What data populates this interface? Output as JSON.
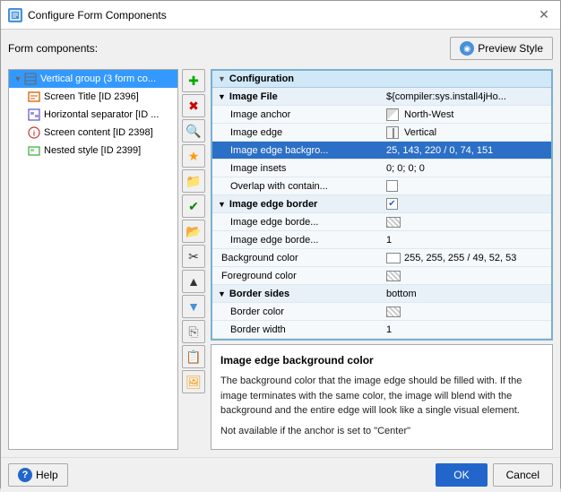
{
  "dialog": {
    "title": "Configure Form Components",
    "title_icon": "⚙",
    "close_icon": "✕"
  },
  "header": {
    "form_components_label": "Form components:",
    "preview_style_label": "Preview Style",
    "preview_style_icon": "◉"
  },
  "tree": {
    "items": [
      {
        "id": "vertical-group",
        "label": "Vertical group (3 form co...",
        "indent": 0,
        "expanded": true,
        "selected": false,
        "icon": "vgroup"
      },
      {
        "id": "screen-title",
        "label": "Screen Title [ID 2396]",
        "indent": 1,
        "selected": false,
        "icon": "screen-title"
      },
      {
        "id": "horizontal-sep",
        "label": "Horizontal separator [ID ...",
        "indent": 1,
        "selected": false,
        "icon": "hsep"
      },
      {
        "id": "screen-content",
        "label": "Screen content [ID 2398]",
        "indent": 1,
        "selected": false,
        "icon": "screen-content"
      },
      {
        "id": "nested-style",
        "label": "Nested style [ID 2399]",
        "indent": 1,
        "selected": false,
        "icon": "nested"
      }
    ]
  },
  "toolbar": {
    "buttons": [
      "add",
      "remove",
      "search",
      "star",
      "folder",
      "check",
      "blue-folder",
      "scissors",
      "up",
      "down",
      "copy",
      "paste",
      "img"
    ]
  },
  "config": {
    "header_label": "Configuration",
    "rows": [
      {
        "type": "group",
        "label": "Image File",
        "value": "${compiler:sys.install4jHo...",
        "indent": 0
      },
      {
        "type": "row",
        "label": "Image anchor",
        "value": "North-West",
        "indent": 1,
        "value_icon": "anchor"
      },
      {
        "type": "row",
        "label": "Image edge",
        "value": "Vertical",
        "indent": 1,
        "value_icon": "vline"
      },
      {
        "type": "row",
        "label": "Image edge backgro...",
        "value": "25, 143, 220 / 0, 74, 151",
        "indent": 1,
        "selected": true
      },
      {
        "type": "row",
        "label": "Image insets",
        "value": "0; 0; 0; 0",
        "indent": 1
      },
      {
        "type": "row",
        "label": "Overlap with contain...",
        "value": "",
        "indent": 1,
        "value_icon": "checkbox"
      },
      {
        "type": "group",
        "label": "Image edge border",
        "value": "",
        "indent": 0,
        "checked": true
      },
      {
        "type": "row",
        "label": "Image edge borde...",
        "value": "",
        "indent": 1,
        "value_icon": "pattern"
      },
      {
        "type": "row",
        "label": "Image edge borde...",
        "value": "1",
        "indent": 1
      },
      {
        "type": "plain",
        "label": "Background color",
        "value": "255, 255, 255 / 49, 52, 53",
        "indent": 0,
        "value_icon": "color-white"
      },
      {
        "type": "plain",
        "label": "Foreground color",
        "value": "",
        "indent": 0,
        "value_icon": "pattern"
      },
      {
        "type": "group",
        "label": "Border sides",
        "value": "bottom",
        "indent": 0
      },
      {
        "type": "row",
        "label": "Border color",
        "value": "",
        "indent": 1,
        "value_icon": "pattern"
      },
      {
        "type": "row",
        "label": "Border width",
        "value": "1",
        "indent": 1
      }
    ]
  },
  "description": {
    "title": "Image edge background color",
    "text1": "The background color that the image edge should be filled with. If the image terminates with the same color, the image will blend with the background and the entire edge will look like a single visual element.",
    "text2": "Not available if the anchor is set to \"Center\""
  },
  "footer": {
    "help_label": "Help",
    "ok_label": "OK",
    "cancel_label": "Cancel"
  }
}
